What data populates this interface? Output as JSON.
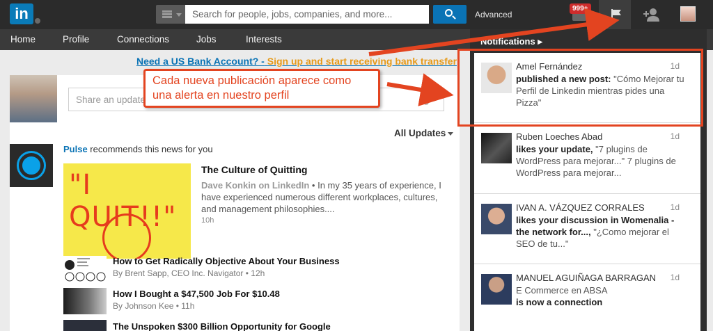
{
  "topbar": {
    "logo_text": "in",
    "search_placeholder": "Search for people, jobs, companies, and more...",
    "advanced_label": "Advanced",
    "messages_badge": "999+"
  },
  "nav": {
    "items": [
      "Home",
      "Profile",
      "Connections",
      "Jobs",
      "Interests"
    ]
  },
  "banner": {
    "lead": "Need a US Bank Account? -",
    "rest": " Sign up and start receiving bank transfer"
  },
  "update_box": {
    "placeholder": "Share an update..."
  },
  "feed": {
    "sort_label": "All Updates",
    "pulse_brand": "Pulse",
    "pulse_text": " recommends this news for you",
    "main_article": {
      "image_text": "\"I QUIT!!\"",
      "title": "The Culture of Quitting",
      "author": "Dave Konkin on LinkedIn",
      "separator": " • ",
      "snippet": "In my 35 years of experience, I have experienced numerous different workplaces, cultures, and management philosophies....",
      "time": "10h"
    },
    "news": [
      {
        "title": "How to Get Radically Objective About Your Business",
        "meta": "By Brent Sapp, CEO Inc. Navigator  • 12h"
      },
      {
        "title": "How I Bought a $47,500 Job For $10.48",
        "meta": "By Johnson Kee  • 11h"
      },
      {
        "title": "The Unspoken $300 Billion Opportunity for Google",
        "meta": ""
      }
    ]
  },
  "notifications": {
    "header": "Notifications",
    "items": [
      {
        "name": "Amel Fernández",
        "time": "1d",
        "action": "published a new post:",
        "detail": " \"Cómo Mejorar tu Perfil de Linkedin mientras pides una Pizza\""
      },
      {
        "name": "Ruben Loeches Abad",
        "time": "1d",
        "action": "likes your update,",
        "detail": " \"7 plugins de WordPress para mejorar...\" 7 plugins de WordPress para mejorar..."
      },
      {
        "name": "IVAN A. VÁZQUEZ CORRALES",
        "time": "1d",
        "action": "likes your discussion in Womenalia - the network for...,",
        "detail": " \"¿Como mejorar el SEO de tu...\""
      },
      {
        "name": "MANUEL AGUIÑAGA BARRAGAN",
        "time": "1d",
        "action_pre": "E Commerce en ABSA",
        "action": "is now a connection",
        "detail": ""
      }
    ]
  },
  "annotation": {
    "callout_text": "Cada nueva publicación aparece como una alerta en nuestro perfil",
    "color": "#e34420"
  }
}
